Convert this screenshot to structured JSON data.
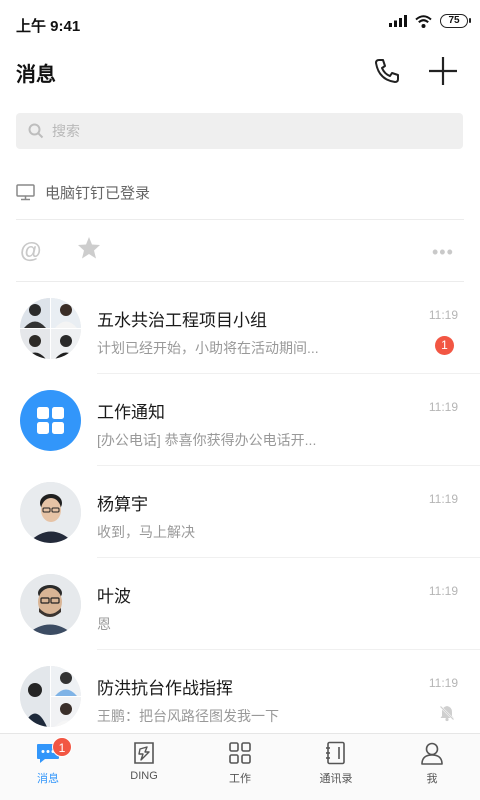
{
  "status": {
    "time": "上午 9:41",
    "battery": "75"
  },
  "header": {
    "title": "消息",
    "phone_icon": "phone-icon",
    "add_icon": "plus-icon"
  },
  "search": {
    "placeholder": "搜索"
  },
  "pc_login": {
    "label": "电脑钉钉已登录"
  },
  "colors": {
    "accent": "#3296fa",
    "badge": "#f25643",
    "work_notice": "#3296fa"
  },
  "chats": [
    {
      "name": "五水共治工程项目小组",
      "preview": "计划已经开始，小助将在活动期间...",
      "time": "11:19",
      "unread": "1",
      "avatar": "group-avatar"
    },
    {
      "name": "工作通知",
      "preview": "[办公电话] 恭喜你获得办公电话开...",
      "time": "11:19",
      "avatar": "work-notice-icon"
    },
    {
      "name": "杨算宇",
      "preview": "收到，马上解决",
      "time": "11:19",
      "avatar": "person-avatar"
    },
    {
      "name": "叶波",
      "preview": "恩",
      "time": "11:19",
      "avatar": "person-avatar"
    },
    {
      "name": "防洪抗台作战指挥",
      "preview": "王鹏：把台风路径图发我一下",
      "time": "11:19",
      "muted": true,
      "avatar": "group-avatar"
    }
  ],
  "tabs": [
    {
      "label": "消息",
      "badge": "1",
      "icon": "chat-bubble-icon"
    },
    {
      "label": "DING",
      "icon": "ding-icon"
    },
    {
      "label": "工作",
      "icon": "grid-icon"
    },
    {
      "label": "通讯录",
      "icon": "contacts-icon"
    },
    {
      "label": "我",
      "icon": "person-icon"
    }
  ]
}
